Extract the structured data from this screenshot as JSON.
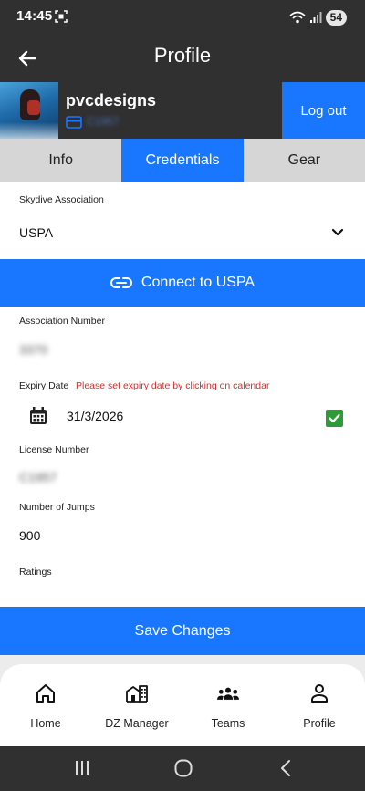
{
  "status_bar": {
    "time": "14:45",
    "battery": "54"
  },
  "app_bar": {
    "title": "Profile"
  },
  "profile": {
    "username": "pvcdesigns",
    "license_id_blurred": "C1957",
    "logout_label": "Log out"
  },
  "tabs": [
    {
      "label": "Info",
      "active": false
    },
    {
      "label": "Credentials",
      "active": true
    },
    {
      "label": "Gear",
      "active": false
    }
  ],
  "credentials": {
    "association_label": "Skydive Association",
    "association_value": "USPA",
    "connect_label": "Connect to USPA",
    "association_number_label": "Association Number",
    "association_number_value": "3370",
    "expiry_label": "Expiry Date",
    "expiry_warning": "Please set expiry date by clicking on calendar",
    "expiry_value": "31/3/2026",
    "expiry_checked": true,
    "license_number_label": "License Number",
    "license_number_value": "C1957",
    "jumps_label": "Number of Jumps",
    "jumps_value": "900",
    "ratings_label": "Ratings"
  },
  "save_label": "Save Changes",
  "bottom_nav": [
    {
      "label": "Home",
      "icon": "home-icon"
    },
    {
      "label": "DZ Manager",
      "icon": "building-icon"
    },
    {
      "label": "Teams",
      "icon": "team-icon"
    },
    {
      "label": "Profile",
      "icon": "person-icon"
    }
  ],
  "colors": {
    "primary": "#1976ff",
    "dark": "#303030",
    "warning": "#d32f2f",
    "check": "#2e9b3a",
    "tab_inactive": "#d6d6d6"
  }
}
